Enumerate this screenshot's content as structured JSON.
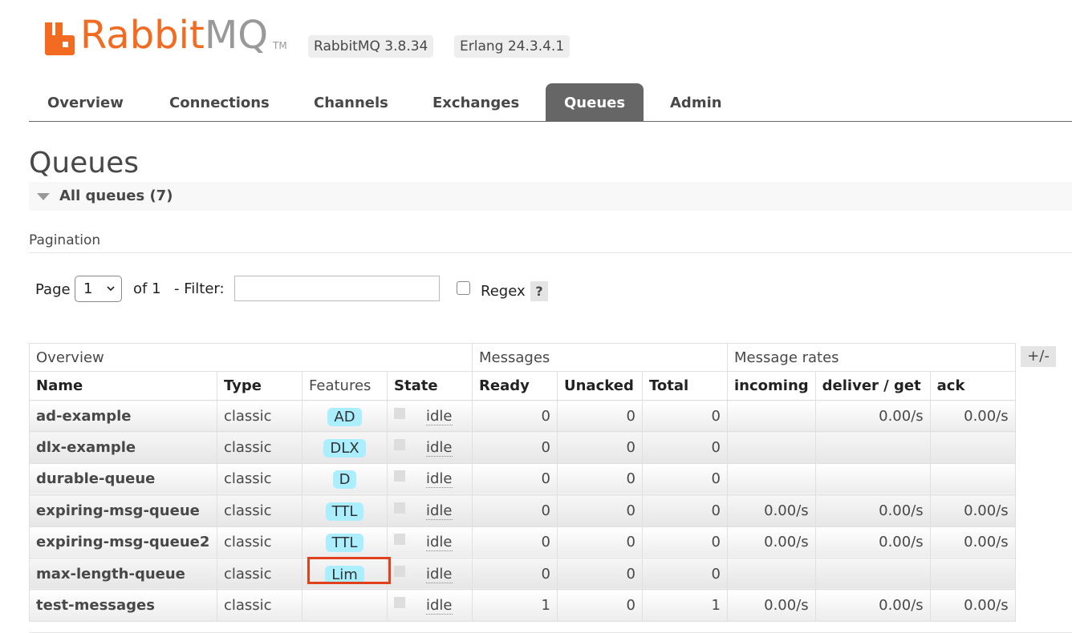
{
  "header": {
    "logo_rabbit": "Rabbit",
    "logo_mq": "MQ",
    "logo_tm": "TM",
    "rabbit_version": "RabbitMQ 3.8.34",
    "erlang_version": "Erlang 24.3.4.1"
  },
  "tabs": [
    {
      "label": "Overview",
      "active": false
    },
    {
      "label": "Connections",
      "active": false
    },
    {
      "label": "Channels",
      "active": false
    },
    {
      "label": "Exchanges",
      "active": false
    },
    {
      "label": "Queues",
      "active": true
    },
    {
      "label": "Admin",
      "active": false
    }
  ],
  "page_title": "Queues",
  "section": {
    "label": "All queues (7)"
  },
  "pagination": {
    "label": "Pagination",
    "page_label": "Page",
    "page_value": "1",
    "of_label": "of 1",
    "filter_label": "- Filter:",
    "filter_value": "",
    "regex_label": "Regex",
    "help_label": "?"
  },
  "table": {
    "groups": [
      "Overview",
      "Messages",
      "Message rates"
    ],
    "columns": [
      "Name",
      "Type",
      "Features",
      "State",
      "Ready",
      "Unacked",
      "Total",
      "incoming",
      "deliver / get",
      "ack"
    ],
    "plus_minus": "+/-",
    "rows": [
      {
        "name": "ad-example",
        "type": "classic",
        "feature": "AD",
        "state": "idle",
        "ready": "0",
        "unacked": "0",
        "total": "0",
        "incoming": "",
        "deliver": "0.00/s",
        "ack": "0.00/s"
      },
      {
        "name": "dlx-example",
        "type": "classic",
        "feature": "DLX",
        "state": "idle",
        "ready": "0",
        "unacked": "0",
        "total": "0",
        "incoming": "",
        "deliver": "",
        "ack": ""
      },
      {
        "name": "durable-queue",
        "type": "classic",
        "feature": "D",
        "state": "idle",
        "ready": "0",
        "unacked": "0",
        "total": "0",
        "incoming": "",
        "deliver": "",
        "ack": ""
      },
      {
        "name": "expiring-msg-queue",
        "type": "classic",
        "feature": "TTL",
        "state": "idle",
        "ready": "0",
        "unacked": "0",
        "total": "0",
        "incoming": "0.00/s",
        "deliver": "0.00/s",
        "ack": "0.00/s"
      },
      {
        "name": "expiring-msg-queue2",
        "type": "classic",
        "feature": "TTL",
        "state": "idle",
        "ready": "0",
        "unacked": "0",
        "total": "0",
        "incoming": "0.00/s",
        "deliver": "0.00/s",
        "ack": "0.00/s"
      },
      {
        "name": "max-length-queue",
        "type": "classic",
        "feature": "Lim",
        "state": "idle",
        "ready": "0",
        "unacked": "0",
        "total": "0",
        "incoming": "",
        "deliver": "",
        "ack": ""
      },
      {
        "name": "test-messages",
        "type": "classic",
        "feature": "",
        "state": "idle",
        "ready": "1",
        "unacked": "0",
        "total": "1",
        "incoming": "0.00/s",
        "deliver": "0.00/s",
        "ack": "0.00/s"
      }
    ]
  },
  "colors": {
    "brand_orange": "#f26b21",
    "active_tab": "#666666",
    "feature_badge": "#aaeeff",
    "highlight": "#e0401c"
  }
}
